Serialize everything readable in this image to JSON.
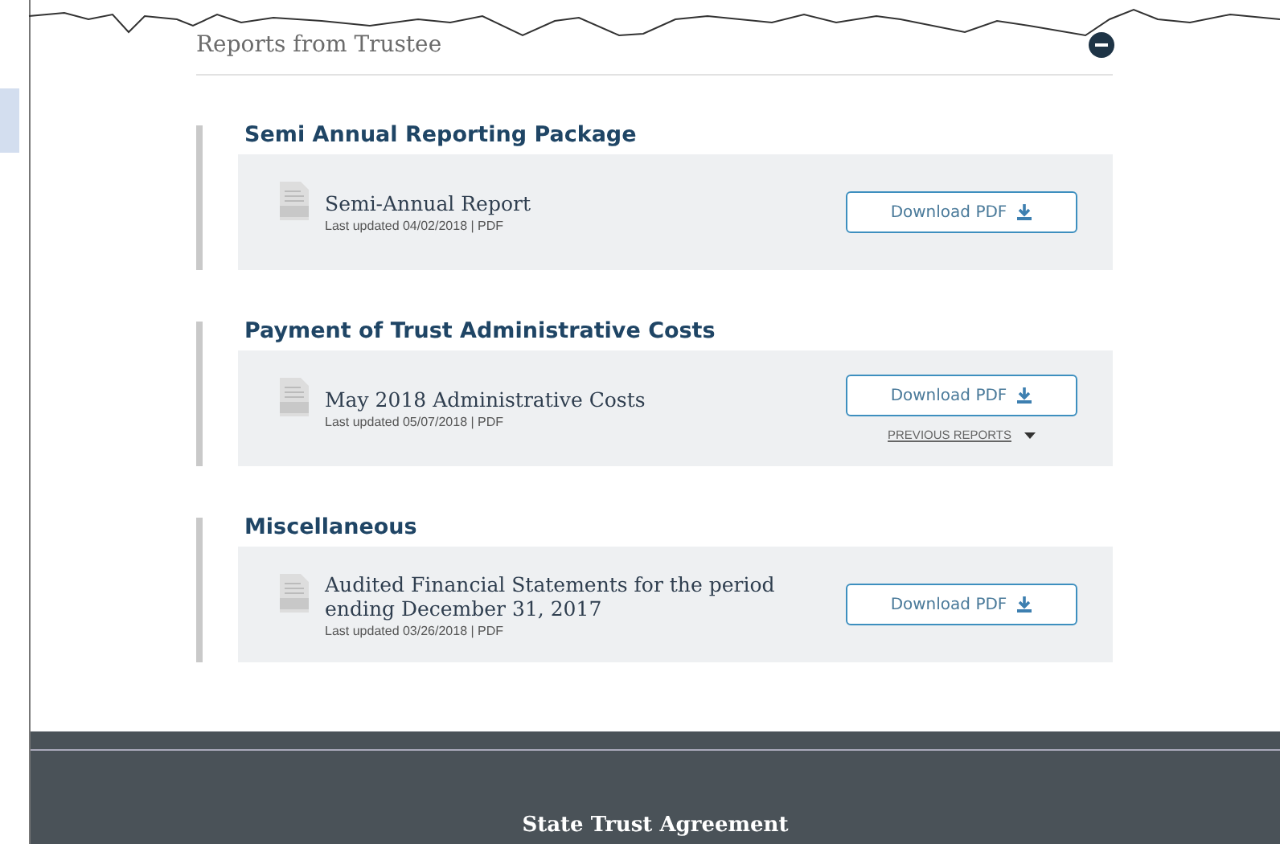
{
  "panel": {
    "title": "Reports from Trustee",
    "expanded": true
  },
  "sections": [
    {
      "heading": "Semi Annual Reporting Package",
      "items": [
        {
          "title": "Semi-Annual Report",
          "meta": "Last updated 04/02/2018 | PDF",
          "button": "Download PDF"
        }
      ]
    },
    {
      "heading": "Payment of Trust Administrative Costs",
      "items": [
        {
          "title": "May 2018 Administrative Costs",
          "meta": "Last updated 05/07/2018 | PDF",
          "button": "Download PDF",
          "more_link": "PREVIOUS REPORTS"
        }
      ]
    },
    {
      "heading": "Miscellaneous",
      "items": [
        {
          "title": "Audited Financial Statements for the period ending December 31, 2017",
          "meta": "Last updated 03/26/2018 | PDF",
          "button": "Download PDF"
        }
      ]
    }
  ],
  "footer": {
    "title": "State Trust Agreement"
  }
}
